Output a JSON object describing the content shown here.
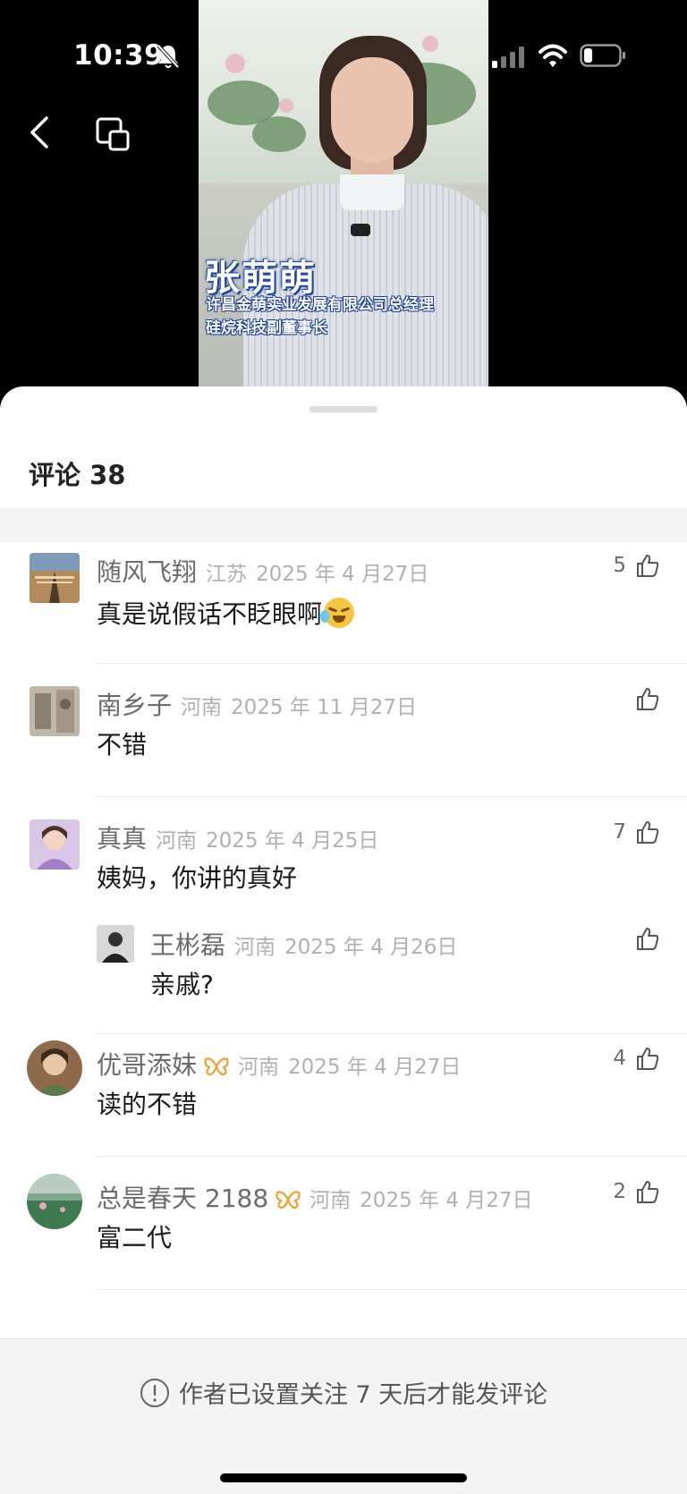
{
  "status_bar": {
    "time": "10:39"
  },
  "video": {
    "top_caption": "",
    "name": "张萌萌",
    "title_line1": "许昌金萌实业发展有限公司总经理",
    "title_line2": "硅烷科技副董事长",
    "bottom_caption": ""
  },
  "comments_header": {
    "title": "评论 38"
  },
  "comments": [
    {
      "user": "随风飞翔",
      "region": "江苏",
      "date": "2025 年 4 月27日",
      "text": "真是说假话不眨眼啊",
      "likes": "5",
      "emoji": "crying-laughing-emoji"
    },
    {
      "user": "南乡子",
      "region": "河南",
      "date": "2025 年 11 月27日",
      "text": "不错",
      "likes": ""
    },
    {
      "user": "真真",
      "region": "河南",
      "date": "2025 年 4 月25日",
      "text": "姨妈，你讲的真好",
      "likes": "7"
    },
    {
      "user": "王彬磊",
      "region": "河南",
      "date": "2025 年 4 月26日",
      "text": "亲戚?",
      "likes": "",
      "reply": true
    },
    {
      "user": "优哥添妹",
      "region": "河南",
      "date": "2025 年 4 月27日",
      "text": "读的不错",
      "likes": "4",
      "badge": "butterfly-icon"
    },
    {
      "user": "总是春天 2188",
      "region": "河南",
      "date": "2025 年 4 月27日",
      "text": "富二代",
      "likes": "2",
      "badge": "butterfly-icon"
    }
  ],
  "footer": {
    "notice": "作者已设置关注 7 天后才能发评论"
  },
  "colors": {
    "accent_badge": "#f0a030",
    "sheet_bg": "#ffffff",
    "footer_bg": "#f4f4f4"
  }
}
